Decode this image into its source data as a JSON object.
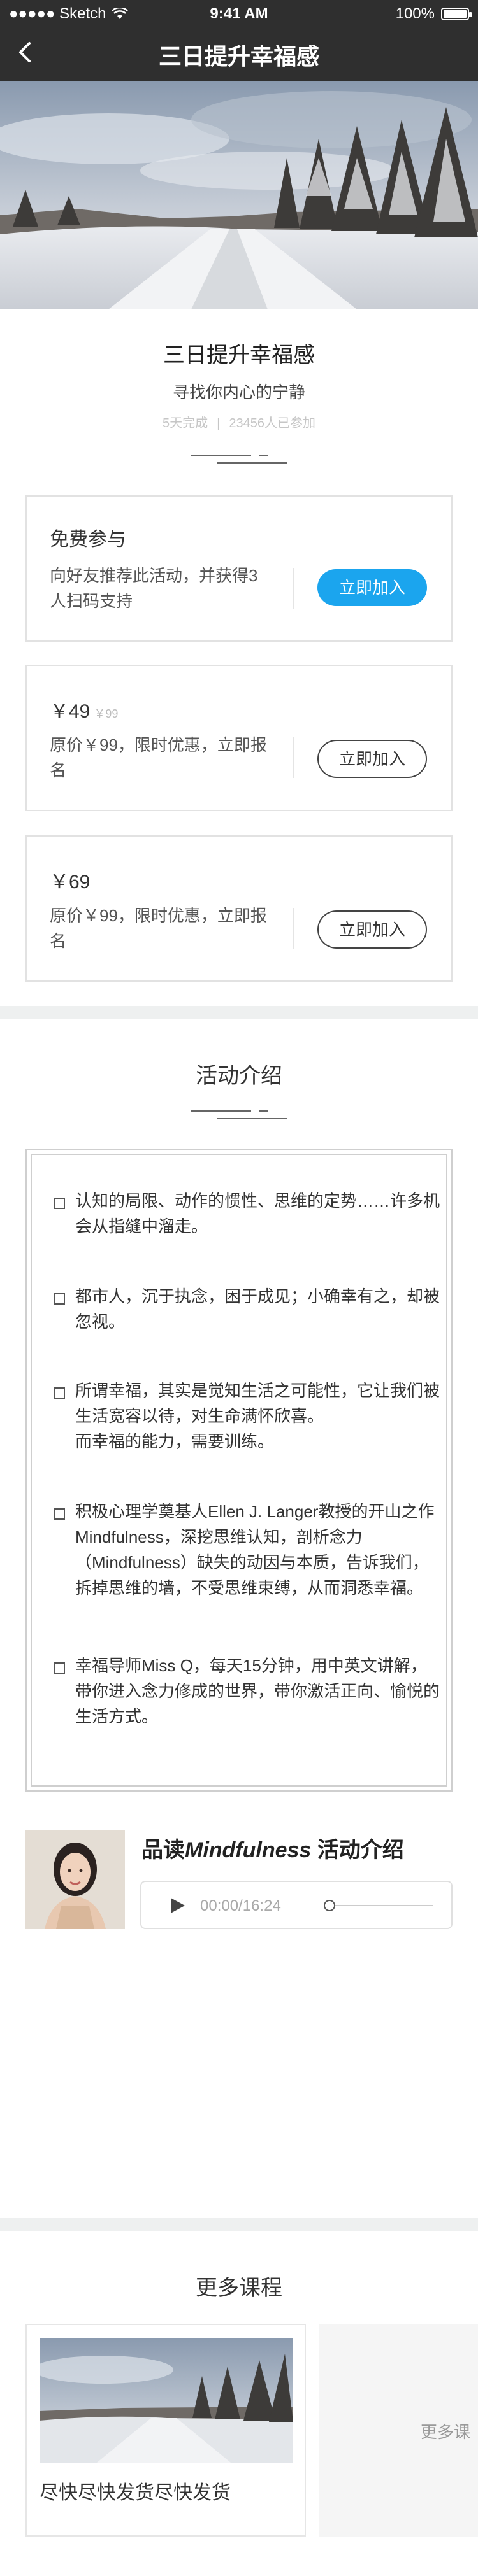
{
  "status_bar": {
    "carrier": "●●●●● Sketch",
    "time": "9:41 AM",
    "battery": "100%"
  },
  "nav": {
    "title": "三日提升幸福感",
    "back_icon": "chevron-left-icon"
  },
  "header": {
    "title": "三日提升幸福感",
    "subtitle": "寻找你内心的宁静",
    "duration": "5天完成",
    "separator": "|",
    "participants": "23456人已参加"
  },
  "plans": [
    {
      "title": "免费参与",
      "desc": "向好友推荐此活动，并获得3人扫码支持",
      "button": "立即加入"
    },
    {
      "price": "￥49",
      "original_price": "￥99",
      "desc": "原价￥99，限时优惠，立即报名",
      "button": "立即加入"
    },
    {
      "price": "￥69",
      "desc": "原价￥99，限时优惠，立即报名",
      "button": "立即加入"
    }
  ],
  "intro": {
    "title": "活动介绍",
    "items": [
      "认知的局限、动作的惯性、思维的定势……许多机会从指缝中溜走。",
      "都市人，沉于执念，困于成见；小确幸有之，却被忽视。",
      "所谓幸福，其实是觉知生活之可能性，它让我们被生活宽容以待，对生命满怀欣喜。\n而幸福的能力，需要训练。",
      "积极心理学奠基人Ellen J. Langer教授的开山之作Mindfulness，深挖思维认知，剖析念力（Mindfulness）缺失的动因与本质，告诉我们，拆掉思维的墙，不受思维束缚，从而洞悉幸福。",
      "幸福导师Miss Q，每天15分钟，用中英文讲解，带你进入念力修成的世界，带你激活正向、愉悦的生活方式。"
    ]
  },
  "audio": {
    "title_prefix": "品读",
    "title_em": "Mindfulness",
    "title_suffix": " 活动介绍",
    "time": "00:00/16:24",
    "progress": 0
  },
  "more": {
    "title": "更多课程",
    "course_name": "尽快尽快发货尽快发货",
    "more_link": "更多课"
  },
  "colors": {
    "navbar": "#2f2f2f",
    "primary_button": "#1ba5ee",
    "section_gap": "#eef0f0"
  }
}
